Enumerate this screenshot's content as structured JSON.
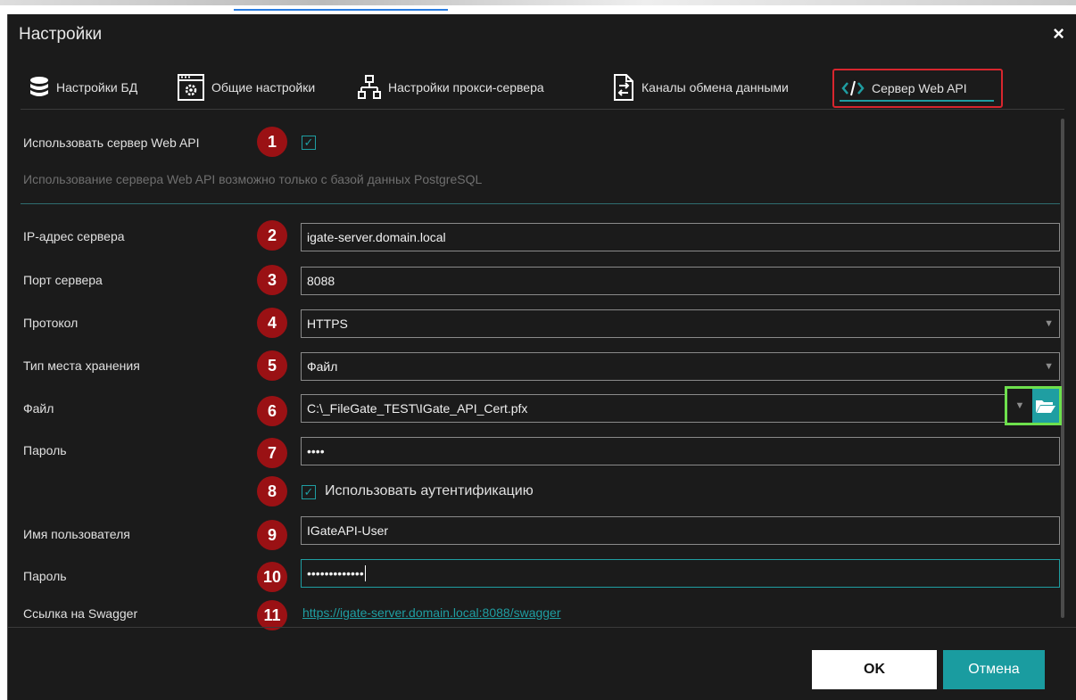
{
  "window": {
    "title": "Настройки",
    "close_glyph": "×"
  },
  "tabs": [
    {
      "label": "Настройки БД",
      "icon": "database-icon"
    },
    {
      "label": "Общие настройки",
      "icon": "settings-window-icon"
    },
    {
      "label": "Настройки прокси-сервера",
      "icon": "network-icon"
    },
    {
      "label": "Каналы обмена данными",
      "icon": "file-exchange-icon"
    },
    {
      "label": "Сервер Web API",
      "icon": "code-icon",
      "active": true
    }
  ],
  "use_webapi": {
    "label": "Использовать сервер Web API",
    "checked": true,
    "hint": "Использование сервера Web API возможно только с базой данных PostgreSQL"
  },
  "fields": {
    "ip": {
      "label": "IP-адрес сервера",
      "value": "igate-server.domain.local"
    },
    "port": {
      "label": "Порт сервера",
      "value": "8088"
    },
    "protocol": {
      "label": "Протокол",
      "value": "HTTPS"
    },
    "storage": {
      "label": "Тип места хранения",
      "value": "Файл"
    },
    "file": {
      "label": "Файл",
      "value": "C:\\_FileGate_TEST\\IGate_API_Cert.pfx"
    },
    "password": {
      "label": "Пароль",
      "value": "••••"
    },
    "use_auth": {
      "label": "Использовать аутентификацию",
      "checked": true
    },
    "username": {
      "label": "Имя пользователя",
      "value": "IGateAPI-User"
    },
    "user_password": {
      "label": "Пароль",
      "value": "•••••••••••••"
    },
    "swagger": {
      "label": "Ссылка на Swagger",
      "url": "https://igate-server.domain.local:8088/swagger"
    }
  },
  "badges": [
    "1",
    "2",
    "3",
    "4",
    "5",
    "6",
    "7",
    "8",
    "9",
    "10",
    "11"
  ],
  "buttons": {
    "ok": "OK",
    "cancel": "Отмена"
  },
  "colors": {
    "accent": "#1f9ea2",
    "badge": "#9a1114",
    "highlight_red": "#d8262e",
    "highlight_green": "#6ee04d",
    "background": "#1b1b1b"
  }
}
